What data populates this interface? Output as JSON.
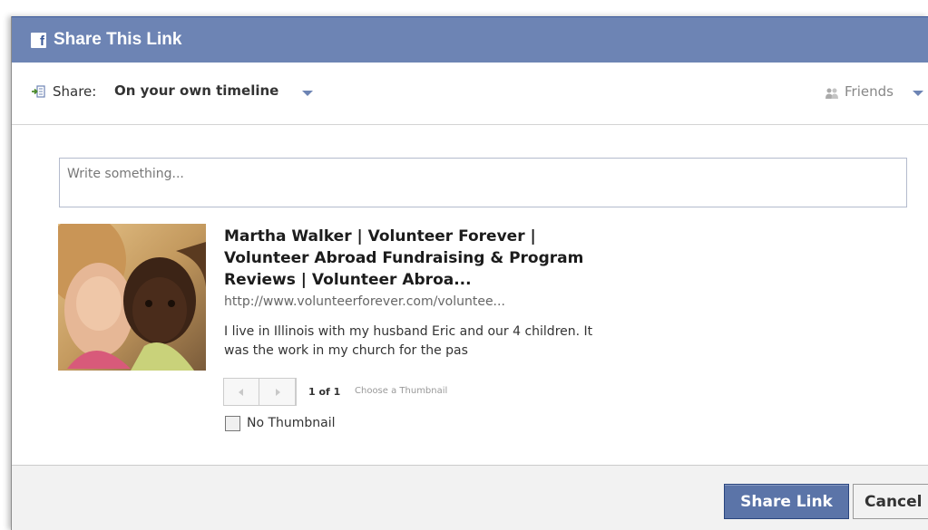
{
  "dialog": {
    "title": "Share This Link",
    "logo_letter": "f"
  },
  "share_bar": {
    "label": "Share:",
    "target": "On your own timeline",
    "audience": "Friends"
  },
  "composer": {
    "placeholder": "Write something..."
  },
  "link": {
    "title": "Martha Walker | Volunteer Forever | Volunteer Abroad Fundraising & Program Reviews | Volunteer Abroa...",
    "url": "http://www.volunteerforever.com/voluntee...",
    "description": "I live in Illinois with my husband Eric and our 4 children. It was the work in my church for the pas"
  },
  "thumbnail": {
    "page_count": "1 of 1",
    "choose_label": "Choose a Thumbnail",
    "no_thumbnail_label": "No Thumbnail",
    "no_thumbnail_checked": false
  },
  "footer": {
    "share_button": "Share Link",
    "cancel_button": "Cancel"
  },
  "colors": {
    "titlebar": "#6d84b4",
    "primary_button": "#5b74a8",
    "link_title": "#1c1c1c"
  }
}
